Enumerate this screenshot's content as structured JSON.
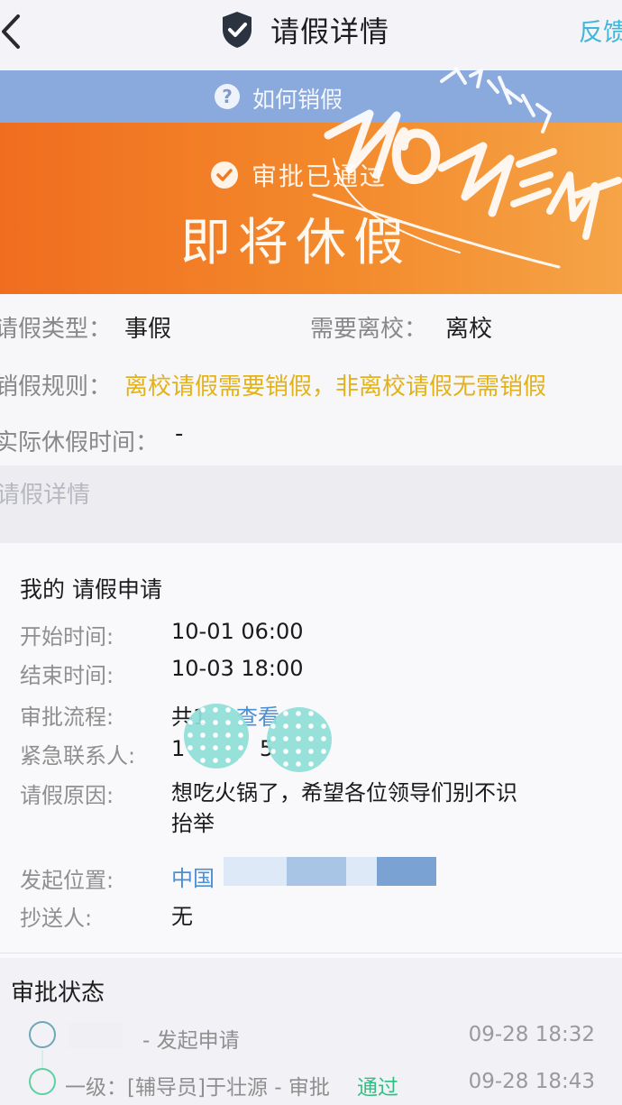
{
  "header": {
    "title": "请假详情",
    "feedback_label": "反馈"
  },
  "help": {
    "text": "如何销假"
  },
  "banner": {
    "approval_status": "审批已通过",
    "leave_status": "即将休假",
    "overlay_text": "MOMENT"
  },
  "info": {
    "type_label": "请假类型：",
    "type_value": "事假",
    "leave_school_label": "需要离校：",
    "leave_school_value": "离校",
    "rule_label": "销假规则：",
    "rule_value": "离校请假需要销假，非离校请假无需销假",
    "actual_label": "实际休假时间：",
    "actual_value": "-"
  },
  "section": {
    "title": "请假详情"
  },
  "application": {
    "title": "我的 请假申请",
    "start_label": "开始时间:",
    "start_value": "10-01 06:00",
    "end_label": "结束时间:",
    "end_value": "10-03 18:00",
    "process_label": "审批流程:",
    "process_value": "共1",
    "process_link": "查看",
    "contact_label": "紧急联系人:",
    "contact_value": "1",
    "contact_tail": "5",
    "reason_label": "请假原因:",
    "reason_value": "想吃火锅了，希望各位领导们别不识抬举",
    "location_label": "发起位置:",
    "location_value": "中国",
    "cc_label": "抄送人:",
    "cc_value": "无"
  },
  "approval": {
    "title": "审批状态",
    "steps": [
      {
        "text": "- 发起申请",
        "pass": "",
        "time": "09-28 18:32"
      },
      {
        "text": "一级：[辅导员]于壮源 - 审批",
        "pass": "通过",
        "time": "09-28 18:43"
      }
    ]
  },
  "colors": {
    "accent": "#3fb6d8",
    "banner_orange": "#f06d1f",
    "warning": "#e2b21d",
    "pass_green": "#2fbf83"
  }
}
